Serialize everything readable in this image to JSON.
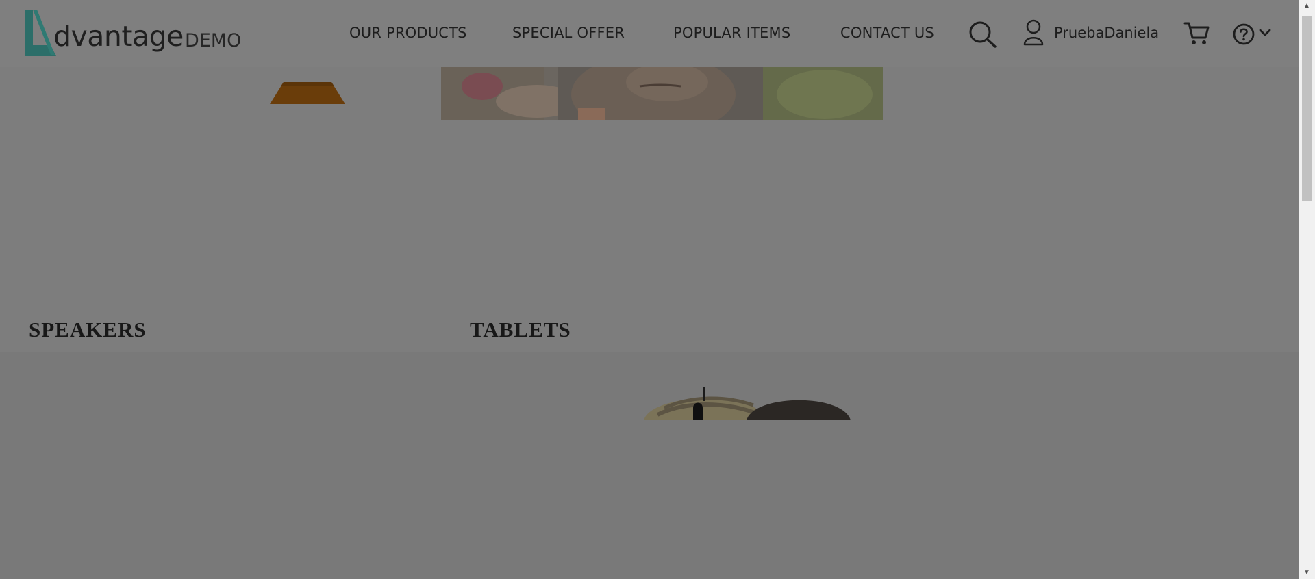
{
  "header": {
    "logo_brand": "dvantage",
    "logo_demo": "DEMO",
    "nav": [
      {
        "label": "OUR PRODUCTS"
      },
      {
        "label": "SPECIAL OFFER"
      },
      {
        "label": "POPULAR ITEMS"
      },
      {
        "label": "CONTACT US"
      }
    ],
    "user": {
      "name": "PruebaDaniela"
    },
    "icons": {
      "search": "search-icon",
      "user": "user-icon",
      "cart": "cart-icon",
      "help": "help-icon",
      "chevron": "chevron-down-icon"
    }
  },
  "categories": [
    {
      "title": "SPEAKERS"
    },
    {
      "title": "TABLETS"
    }
  ],
  "colors": {
    "overlay": "#7a7a7a",
    "header": "#7f7f7f",
    "logo_accent": "#2c6e69",
    "text": "#1d1d1d"
  }
}
